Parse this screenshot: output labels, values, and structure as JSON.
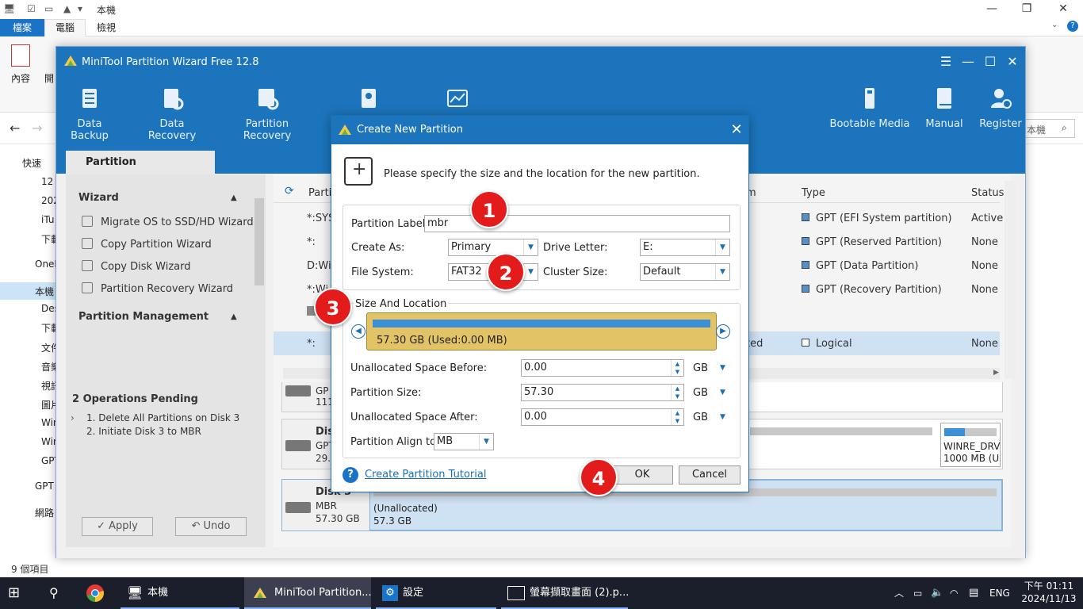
{
  "explorer": {
    "title": "本機",
    "tabs": [
      "檔案",
      "電腦",
      "檢視"
    ],
    "ribbon_properties": "內容",
    "ribbon_open": "開",
    "search_placeholder": "本機",
    "nav_items": [
      "快速",
      "12",
      "202",
      "iTu",
      "下載",
      "OneD",
      "本機",
      "Des",
      "下載",
      "文件",
      "音樂",
      "視訊",
      "圖片",
      "Win",
      "Win",
      "GPT",
      "GPT",
      "網路"
    ],
    "status": "9 個項目"
  },
  "app": {
    "title": "MiniTool Partition Wizard Free 12.8",
    "toolbar": [
      "Data Backup",
      "Data Recovery",
      "Partition Recovery",
      "Bootable Media",
      "Manual",
      "Register"
    ],
    "tab": "Partition Management",
    "wizard_header": "Wizard",
    "wizard_items": [
      "Migrate OS to SSD/HD Wizard",
      "Copy Partition Wizard",
      "Copy Disk Wizard",
      "Partition Recovery Wizard"
    ],
    "pm_header": "Partition Management",
    "ops_header": "2 Operations Pending",
    "ops": [
      "1. Delete All Partitions on Disk 3",
      "2. Initiate Disk 3 to MBR"
    ],
    "apply": "Apply",
    "undo": "Undo",
    "grid_headers": {
      "partition": "Partiti",
      "fs": "m",
      "type": "Type",
      "status": "Status"
    },
    "rows": [
      {
        "partition": "*:SYST",
        "fs": "",
        "type": "GPT (EFI System partition)",
        "status": "Active"
      },
      {
        "partition": "*:",
        "fs": "",
        "type": "GPT (Reserved Partition)",
        "status": "None"
      },
      {
        "partition": "D:Win",
        "fs": "",
        "type": "GPT (Data Partition)",
        "status": "None"
      },
      {
        "partition": "*:Wi",
        "fs": "",
        "type": "GPT (Recovery Partition)",
        "status": "None"
      },
      {
        "partition": "*:",
        "fs": "ted",
        "type": "Logical",
        "status": "None"
      }
    ],
    "disks": [
      {
        "name": "",
        "sub1": "GP",
        "sub2": "111"
      },
      {
        "name": "Disk",
        "sub1": "GPT",
        "sub2": "29.1",
        "right_label": "WINRE_DRV",
        "right_size": "1000 MB (U"
      },
      {
        "name": "Disk 3",
        "sub1": "MBR",
        "sub2": "57.30 GB",
        "part_label": "(Unallocated)",
        "part_size": "57.3 GB"
      }
    ]
  },
  "dialog": {
    "title": "Create New Partition",
    "intro": "Please specify the size and the location for the new partition.",
    "partition_label_label": "Partition Label:",
    "partition_label_value": "mbr",
    "create_as_label": "Create As:",
    "create_as_value": "Primary",
    "drive_letter_label": "Drive Letter:",
    "drive_letter_value": "E:",
    "file_system_label": "File System:",
    "file_system_value": "FAT32",
    "cluster_size_label": "Cluster Size:",
    "cluster_size_value": "Default",
    "size_location_legend": "Size And Location",
    "bar_text": "57.30 GB (Used:0.00 MB)",
    "unalloc_before_label": "Unallocated Space Before:",
    "unalloc_before_value": "0.00",
    "partition_size_label": "Partition Size:",
    "partition_size_value": "57.30",
    "unalloc_after_label": "Unallocated Space After:",
    "unalloc_after_value": "0.00",
    "unit": "GB",
    "align_label": "Partition Align to:",
    "align_value": "MB",
    "tutorial_link": "Create Partition Tutorial",
    "ok": "OK",
    "cancel": "Cancel"
  },
  "markers": [
    "1",
    "2",
    "3",
    "4"
  ],
  "taskbar": {
    "items": [
      "本機",
      "MiniTool Partition...",
      "設定",
      "螢幕擷取畫面 (2).p..."
    ],
    "lang": "ENG",
    "time": "下午 01:11",
    "date": "2024/11/13"
  },
  "colors": {
    "accent": "#1c75bc",
    "marker": "#e31b1b",
    "bar_fill": "#e2c466",
    "bar_used": "#3a8fd6"
  }
}
